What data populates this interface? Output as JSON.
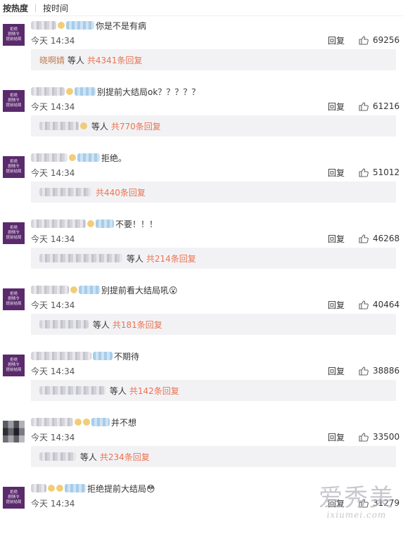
{
  "tabs": {
    "hot": "按热度",
    "time": "按时间"
  },
  "ui": {
    "reply": "回复",
    "and": "等人",
    "like_icon": "thumbs-up-icon"
  },
  "avatar_text": [
    "拒绝",
    "剧情令",
    "提前结局"
  ],
  "comments": [
    {
      "text": "你是不是有病",
      "time": "今天 14:34",
      "likes": "69256",
      "sub_name": "晓啊婧",
      "sub_total": "共4341条回复"
    },
    {
      "text": "别提前大结局ok？？？？？",
      "time": "今天 14:34",
      "likes": "61216",
      "sub_name": "",
      "sub_total": "共770条回复"
    },
    {
      "text": "拒绝。",
      "time": "今天 14:34",
      "likes": "51012",
      "sub_name": "",
      "sub_total": "共440条回复"
    },
    {
      "text": "不要！！！",
      "time": "今天 14:34",
      "likes": "46268",
      "sub_name": "",
      "sub_total": "共214条回复"
    },
    {
      "text": "别提前看大结局吼😮",
      "time": "今天 14:34",
      "likes": "40464",
      "sub_name": "",
      "sub_total": "共181条回复"
    },
    {
      "text": "不期待",
      "time": "今天 14:34",
      "likes": "38886",
      "sub_name": "",
      "sub_total": "共142条回复"
    },
    {
      "text": "并不想",
      "time": "今天 14:34",
      "likes": "33500",
      "sub_name": "",
      "sub_total": "共234条回复"
    },
    {
      "text": "拒绝提前大结局😳",
      "time": "今天 14:34",
      "likes": "31279"
    }
  ],
  "watermark": {
    "top": "爱秀美",
    "bottom": "ixiumei.com"
  }
}
